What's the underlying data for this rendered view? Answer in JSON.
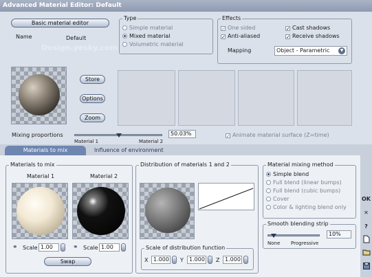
{
  "window": {
    "title": "Advanced Material Editor: Default"
  },
  "material": {
    "editor_button": "Basic material editor",
    "name_label": "Name",
    "name_value": "Default"
  },
  "type": {
    "title": "Type",
    "options": [
      "Simple material",
      "Mixed material",
      "Volumetric material"
    ],
    "selected": "Mixed material"
  },
  "effects": {
    "title": "Effects",
    "one_sided": "One sided",
    "anti_aliased": "Anti-aliased",
    "cast_shadows": "Cast shadows",
    "receive_shadows": "Receive shadows",
    "mapping_label": "Mapping",
    "mapping_value": "Object - Parametric"
  },
  "buttons": {
    "store": "Store",
    "options": "Options",
    "zoom": "Zoom",
    "swap": "Swap"
  },
  "mixing": {
    "label": "Mixing proportions",
    "value": "50.03%",
    "proportion": 0.5003,
    "material1": "Material 1",
    "material2": "Material 2",
    "animate": "Animate material surface (Z=time)"
  },
  "tabs": [
    "Materials to mix",
    "Influence of environment"
  ],
  "materials_to_mix": {
    "title": "Materials to mix",
    "material1_label": "Material 1",
    "material2_label": "Material 2",
    "scale_label": "Scale",
    "scale1": "1.00",
    "scale2": "1.00"
  },
  "distribution": {
    "title": "Distribution of materials 1 and 2",
    "scale_title": "Scale of distribution function",
    "x_label": "X",
    "x_value": "1.000",
    "y_label": "Y",
    "y_value": "1.000",
    "z_label": "Z",
    "z_value": "1.000"
  },
  "mixing_method": {
    "title": "Material mixing method",
    "options": [
      "Simple blend",
      "Full blend (linear bumps)",
      "Full blend (cubic bumps)",
      "Cover",
      "Color & lighting blend only"
    ],
    "selected": "Simple blend"
  },
  "smooth": {
    "title": "Smooth blending strip",
    "value": "10%",
    "level": 0.1,
    "none_label": "None",
    "progressive_label": "Progressive"
  },
  "sidebar": {
    "ok": "OK",
    "cancel": "✕",
    "help": "?"
  },
  "watermark": {
    "text": "Design.yesky.com"
  }
}
